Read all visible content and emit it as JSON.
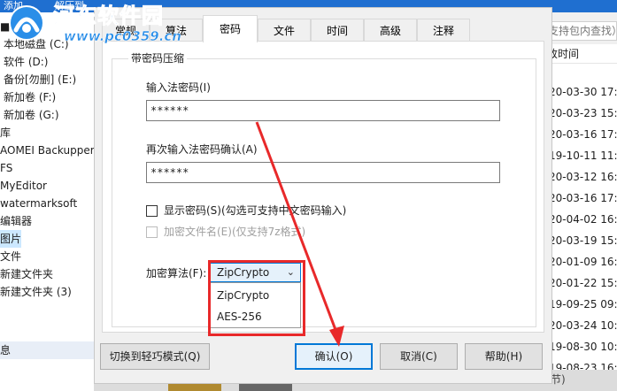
{
  "background": {
    "top_bar": [
      "添加",
      "解压到"
    ],
    "sidebar_items": [
      "桌面",
      "本地磁盘 (C:)",
      "软件 (D:)",
      "备份[勿删] (E:)",
      "新加卷 (F:)",
      "新加卷 (G:)",
      "库",
      "AOMEI Backupper",
      "FS",
      "MyEditor",
      "watermarksoft",
      "编辑器",
      "图片",
      "文件",
      "新建文件夹",
      "新建文件夹 (3)"
    ],
    "status_text": "息",
    "search_placeholder": "支持包内查找）",
    "list_header": "改时间",
    "list_dates": [
      "20-03-30 17:2",
      "20-03-23 15:2",
      "20-03-16 17:1",
      "19-10-11 11:4",
      "20-03-12 16:4",
      "20-03-16 17:5",
      "20-04-02 16:1",
      "20-03-19 15:2",
      "20-01-09 16:1",
      "20-01-22 15:5",
      "19-09-25 09:3",
      "20-03-24 10:3",
      "19-08-30 10:3",
      "19-08-23 16:1"
    ],
    "bottom_text": "节)"
  },
  "watermark": {
    "name": "河东软件园",
    "url": "www.pc0359.cn"
  },
  "dialog": {
    "tabs": [
      "常规",
      "算法",
      "密码",
      "文件",
      "时间",
      "高级",
      "注释"
    ],
    "active_tab": "密码",
    "group_title": "带密码压缩",
    "password_label": "输入法密码(I)",
    "password_value": "******",
    "confirm_label": "再次输入法密码确认(A)",
    "confirm_value": "******",
    "show_password_label": "显示密码(S)(勾选可支持中文密码输入)",
    "encrypt_filename_label": "加密文件名(E)(仅支持7z格式)",
    "algorithm_label": "加密算法(F):",
    "algorithm_selected": "ZipCrypto",
    "algorithm_options": [
      "ZipCrypto",
      "AES-256"
    ],
    "buttons": {
      "switch_mode": "切换到轻巧模式(Q)",
      "ok": "确认(O)",
      "cancel": "取消(C)",
      "help": "帮助(H)"
    }
  },
  "colors": {
    "accent": "#0078d7",
    "annotation_red": "#e8292a",
    "watermark_blue": "#2a8ee8"
  }
}
